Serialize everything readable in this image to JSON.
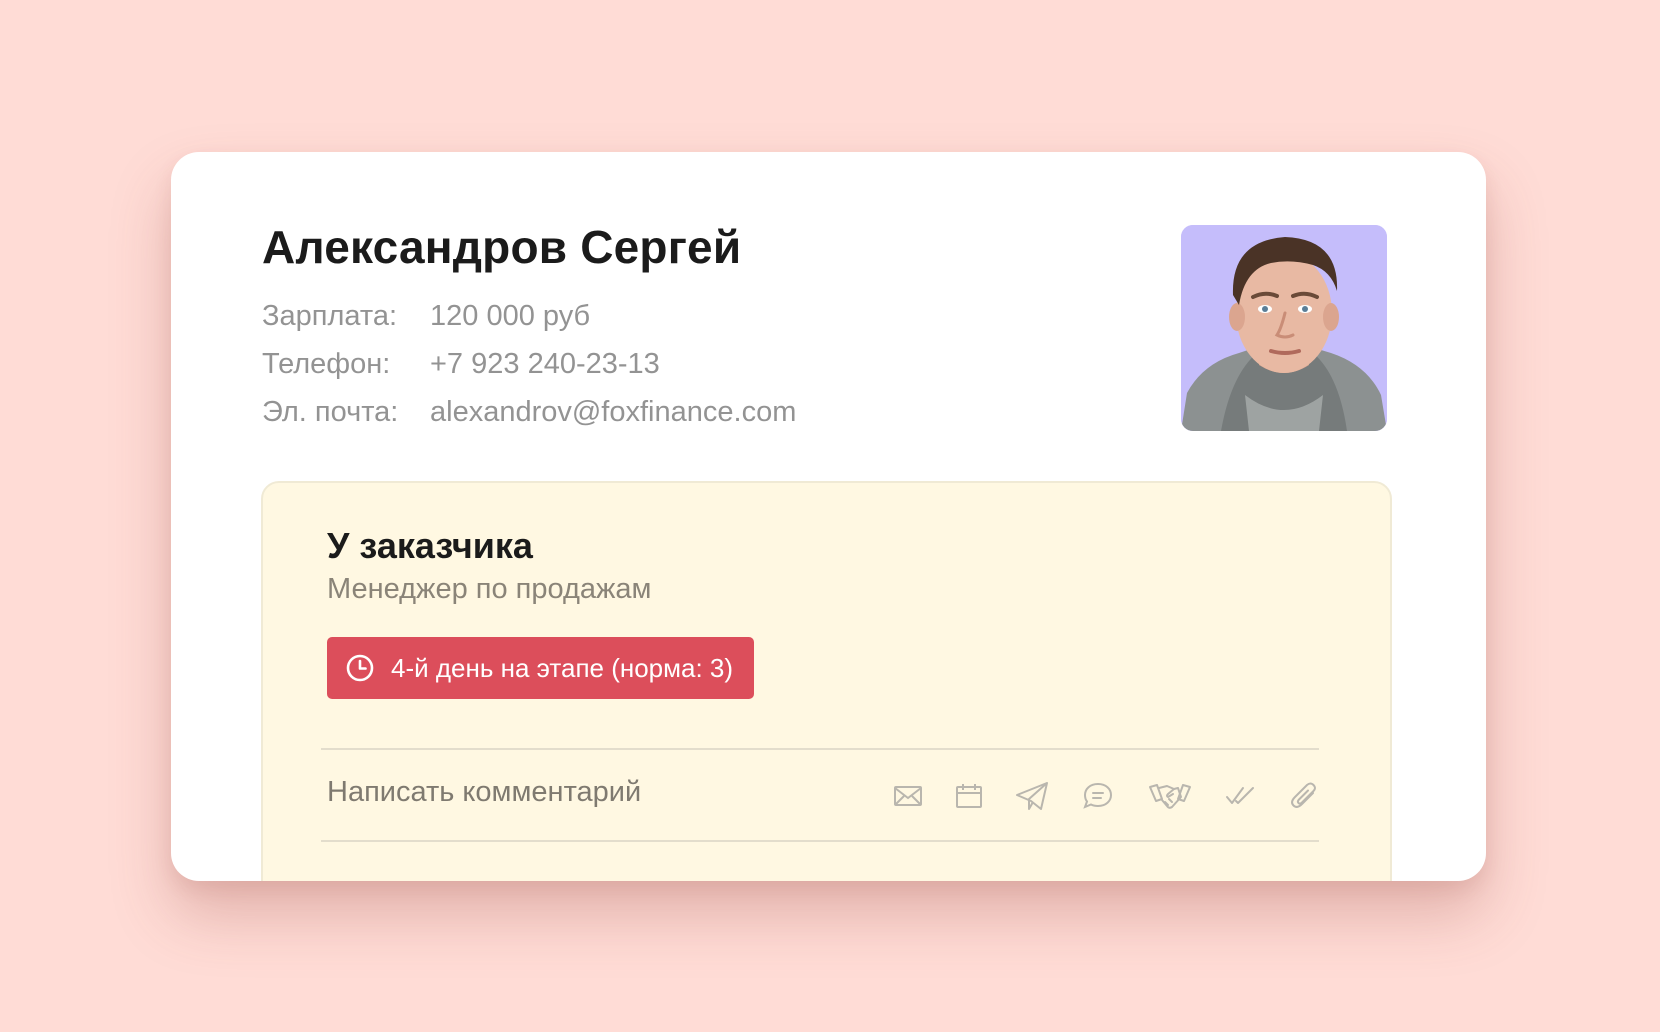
{
  "candidate": {
    "name": "Александров Сергей",
    "fields": {
      "salary": {
        "label": "Зарплата:",
        "value": "120 000 руб"
      },
      "phone": {
        "label": "Телефон:",
        "value": "+7 923 240-23-13"
      },
      "email": {
        "label": "Эл. почта:",
        "value": "alexandrov@foxfinance.com"
      }
    },
    "avatar_bg": "#c5bdfb"
  },
  "stage": {
    "title": "У заказчика",
    "position": "Менеджер по продажам",
    "badge": {
      "icon": "clock-icon",
      "text": "4-й день на этапе (норма: 3)",
      "color": "#dc4e5b"
    }
  },
  "comment": {
    "placeholder": "Написать комментарий",
    "icons": [
      "mail-icon",
      "calendar-icon",
      "send-icon",
      "chat-icon",
      "handshake-icon",
      "double-check-icon",
      "paperclip-icon"
    ]
  },
  "colors": {
    "background": "#ffdcd6",
    "card": "#ffffff",
    "stage_box": "#fff8e2"
  }
}
